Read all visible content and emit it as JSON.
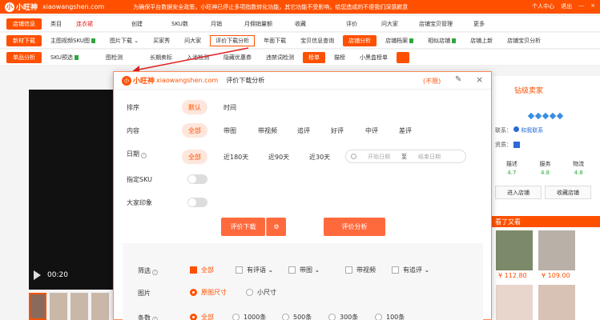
{
  "topbar": {
    "logo_char": "小",
    "logo_text": "小旺神",
    "site": "xiaowangshen.com",
    "notice": "为确保平台数据安全政策，小旺神已停止多项指数转化功能，其它功能不受影响，给您造成的不便我们深感歉意",
    "user": "个人中心",
    "logout": "退出",
    "minimize": "—",
    "close": "×"
  },
  "row1": {
    "label": "店铺信息",
    "items": [
      "类目",
      "连衣裙",
      "创建",
      "SKU数",
      "月销",
      "月佣销量额",
      "收藏",
      "评价",
      "问大家",
      "店铺宝贝管理",
      "更多"
    ]
  },
  "row2": {
    "label": "新材下载",
    "items": [
      "主图视频SKU图",
      "图片下载",
      "买家秀",
      "问大家",
      "评价下载分析",
      "年面下载",
      "宝贝信息查询",
      "店铺分析",
      "店铺档案",
      "相似店铺",
      "店铺上新",
      "店铺宝贝分析"
    ]
  },
  "row3": {
    "label": "单品分析",
    "items": [
      "SKU预选",
      "图检测",
      "长期卖标",
      "入池检测",
      "隐藏优惠券",
      "违禁词检测",
      "榜单",
      "猫榜",
      "小黑盒榜单"
    ]
  },
  "player": {
    "time": "00:20"
  },
  "seller": {
    "title": "钻级卖家",
    "contact_label": "联系：",
    "contact_btn": "和我联系",
    "qual_label": "资质：",
    "scores": [
      {
        "name": "描述",
        "val": "4.7"
      },
      {
        "name": "服务",
        "val": "4.8"
      },
      {
        "name": "物流",
        "val": "4.8"
      }
    ],
    "enter_shop": "进入店铺",
    "fav_shop": "收藏店铺",
    "also_title": "看了又看",
    "prices": [
      "¥ 112.80",
      "¥ 109.00"
    ]
  },
  "modal": {
    "logo_char": "小",
    "logo_text": "小旺神",
    "site": "xiaowangshen.com",
    "title": "评价下载分析",
    "limit": "(不限)",
    "edit": "✎",
    "close": "×",
    "sort": {
      "label": "排序",
      "options": [
        "默认",
        "时间"
      ]
    },
    "content": {
      "label": "内容",
      "options": [
        "全部",
        "带图",
        "带视频",
        "追评",
        "好评",
        "中评",
        "差评"
      ]
    },
    "date": {
      "label": "日期",
      "options": [
        "全部",
        "近180天",
        "近90天",
        "近30天"
      ],
      "start_placeholder": "开始日期",
      "sep": "至",
      "end_placeholder": "结束日期"
    },
    "sku": {
      "label": "指定SKU"
    },
    "impression": {
      "label": "大家印象"
    },
    "download_btn": "评价下载",
    "gear": "⚙",
    "analysis_btn": "评价分析",
    "filter": {
      "label": "筛选",
      "options": [
        "全部",
        "有评语",
        "带图",
        "带视频",
        "有追评"
      ]
    },
    "image": {
      "label": "图片",
      "options": [
        "原图尺寸",
        "小尺寸"
      ]
    },
    "count": {
      "label": "条数",
      "options": [
        "全部",
        "1000条",
        "500条",
        "300条",
        "100条"
      ]
    }
  },
  "colors": {
    "accent": "#ff5000",
    "green": "#2ea83c"
  }
}
